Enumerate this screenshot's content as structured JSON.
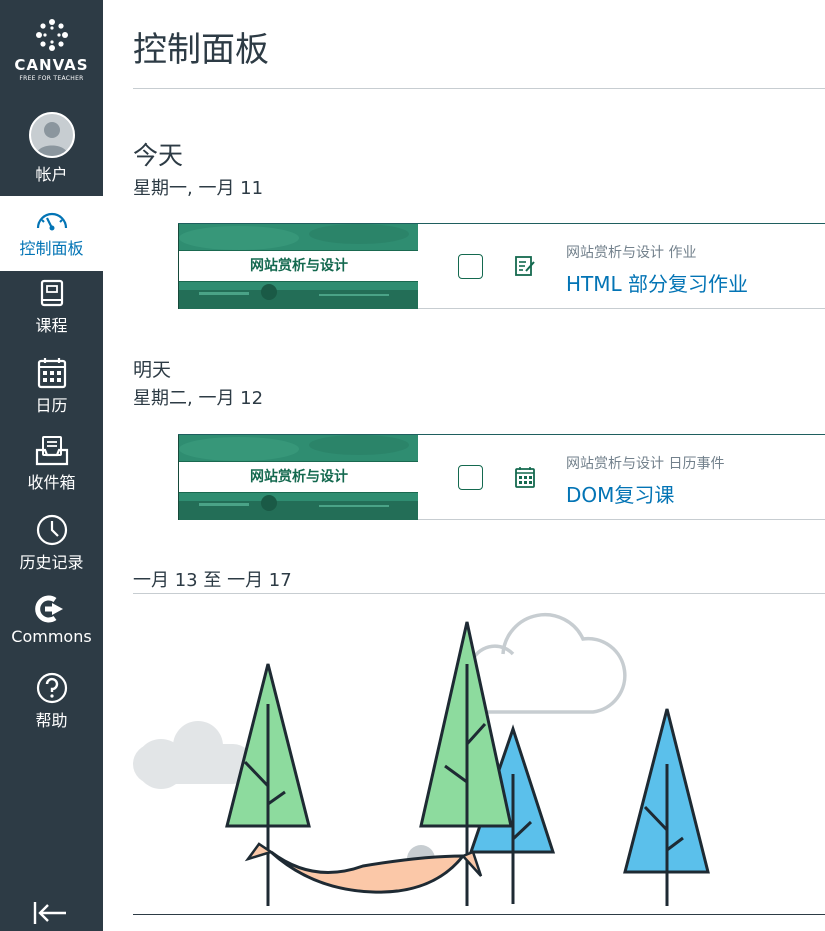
{
  "brand": {
    "word": "CANVAS",
    "sub": "FREE FOR TEACHER"
  },
  "nav": {
    "account": "帐户",
    "dashboard": "控制面板",
    "courses": "课程",
    "calendar": "日历",
    "inbox": "收件箱",
    "history": "历史记录",
    "commons": "Commons",
    "help": "帮助"
  },
  "page": {
    "title": "控制面板"
  },
  "days": [
    {
      "heading": "今天",
      "date": "星期一, 一月 11",
      "item": {
        "course": "网站赏析与设计",
        "meta": "网站赏析与设计 作业",
        "title": "HTML 部分复习作业",
        "icon": "assignment-icon"
      }
    },
    {
      "heading": "明天",
      "date": "星期二, 一月 12",
      "item": {
        "course": "网站赏析与设计",
        "meta": "网站赏析与设计 日历事件",
        "title": "DOM复习课",
        "icon": "calendar-event-icon"
      }
    }
  ],
  "week": {
    "range": "一月 13 至 一月 17"
  },
  "colors": {
    "sidebar": "#2d3b45",
    "link": "#0374b5",
    "course": "#2c8a6e"
  }
}
